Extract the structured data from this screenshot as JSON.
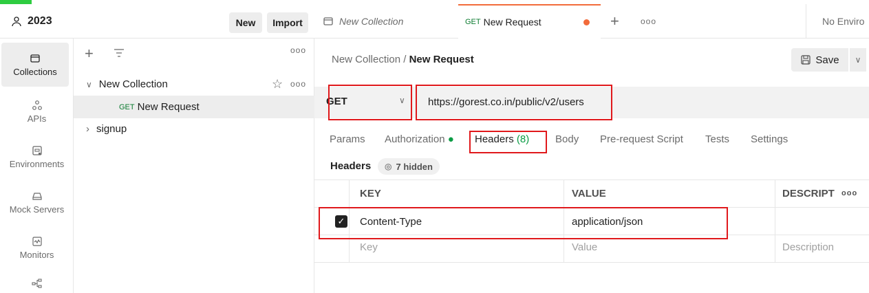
{
  "workspace": {
    "name": "2023",
    "new_label": "New",
    "import_label": "Import"
  },
  "rail": [
    {
      "label": "Collections",
      "icon": "collections-icon"
    },
    {
      "label": "APIs",
      "icon": "apis-icon"
    },
    {
      "label": "Environments",
      "icon": "environments-icon"
    },
    {
      "label": "Mock Servers",
      "icon": "mock-servers-icon"
    },
    {
      "label": "Monitors",
      "icon": "monitors-icon"
    }
  ],
  "tree": {
    "collection": "New Collection",
    "request_method": "GET",
    "request_name": "New Request",
    "folder": "signup"
  },
  "tabs": {
    "tab1": "New Collection",
    "tab2_method": "GET",
    "tab2": "New Request",
    "env": "No Enviro"
  },
  "breadcrumb": {
    "parent": "New Collection",
    "sep": "/",
    "current": "New Request"
  },
  "save_label": "Save",
  "request": {
    "method": "GET",
    "url": "https://gorest.co.in/public/v2/users"
  },
  "req_tabs": {
    "params": "Params",
    "auth": "Authorization",
    "headers": "Headers",
    "headers_count": "(8)",
    "body": "Body",
    "prerequest": "Pre-request Script",
    "tests": "Tests",
    "settings": "Settings"
  },
  "headers_section": {
    "title": "Headers",
    "hidden": "7 hidden"
  },
  "table": {
    "key_col": "KEY",
    "value_col": "VALUE",
    "desc_col": "DESCRIPT",
    "row_key": "Content-Type",
    "row_value": "application/json",
    "ph_key": "Key",
    "ph_value": "Value",
    "ph_desc": "Description"
  },
  "colors": {
    "accent": "#f26b3a",
    "highlight": "#e0181b",
    "get": "#0a7a2f"
  }
}
